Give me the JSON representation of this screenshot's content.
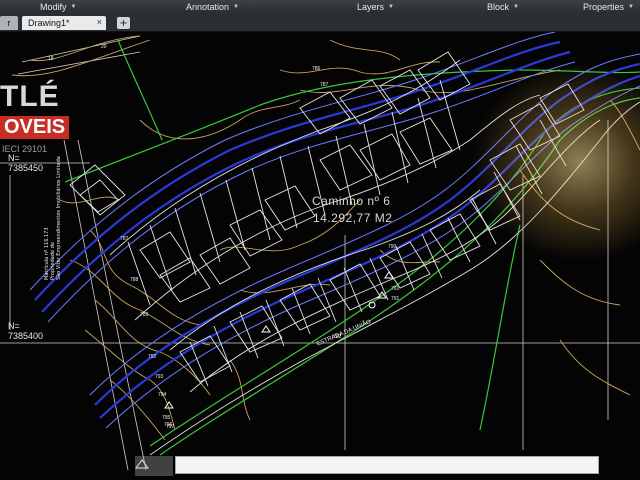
{
  "menubar": {
    "items": [
      {
        "label": "Modify"
      },
      {
        "label": "Annotation"
      },
      {
        "label": "Layers"
      },
      {
        "label": "Block"
      },
      {
        "label": "Properties"
      }
    ]
  },
  "tabs": {
    "start_label": "r",
    "drawing_label": "Drawing1*",
    "close_glyph": "×",
    "add_glyph": "+"
  },
  "drawing": {
    "northing_1": "N=",
    "northing_1_value": "7385450",
    "northing_2": "N=",
    "northing_2_value": "7385400",
    "lot_name": "Caminho nº 6",
    "lot_area": "14.292,77 M2",
    "road_label": "ESTRADA DA UNIÃO",
    "vertical_note_1": "Matrícula nº 116.173",
    "vertical_note_2": "Propriedade de",
    "vertical_note_3": "São Vitor Empreendimentos Imobiliários Limitada",
    "contours": [
      "18",
      "20",
      "786",
      "787",
      "787",
      "788",
      "789",
      "790",
      "791",
      "791",
      "792",
      "792",
      "793",
      "794",
      "795",
      "796",
      "797"
    ]
  },
  "watermark": {
    "line1": "TLÉ",
    "line2": "OVEIS",
    "line3": "IECI 29101"
  },
  "colors": {
    "road_blue": "#2a3ad8",
    "road_blue_light": "#6b7cff",
    "green": "#37c83a",
    "contour": "#c9a35c",
    "lot": "#e6e6e6",
    "grid": "#d0d0d0"
  }
}
